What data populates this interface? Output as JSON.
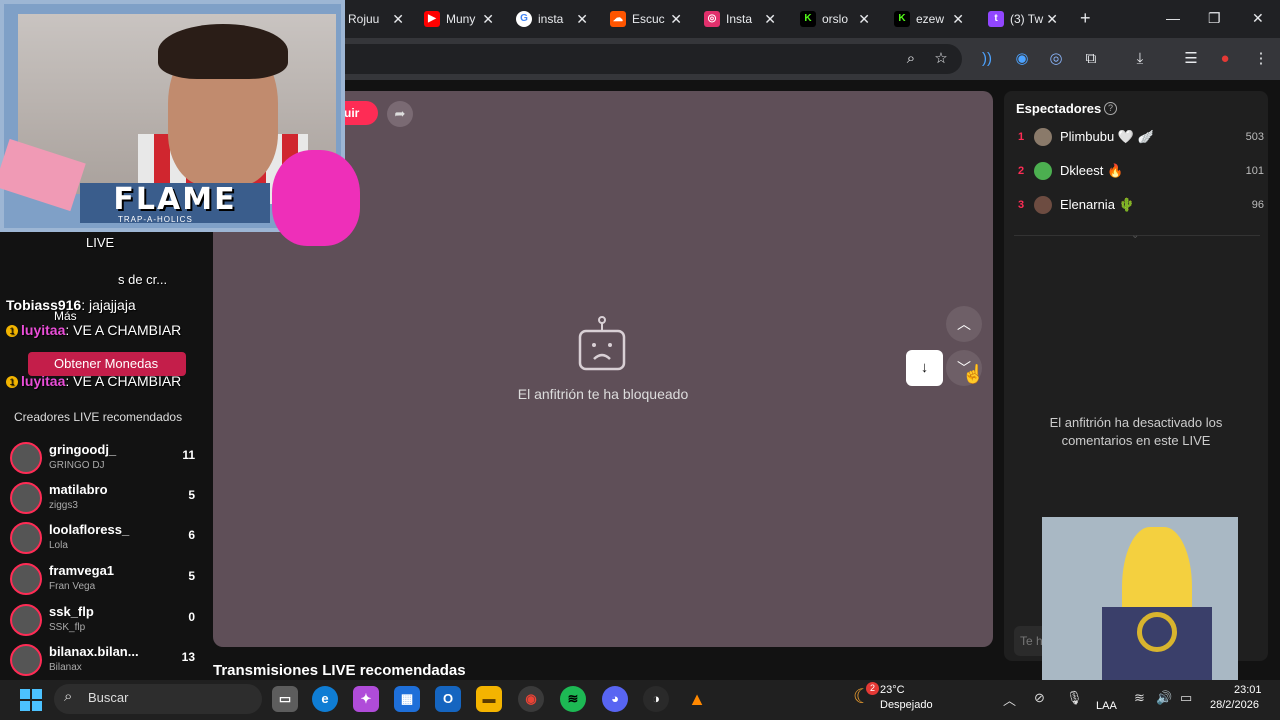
{
  "browser": {
    "tabs": [
      {
        "label": "Rojuu",
        "icon": "generic-tab-icon",
        "icon_color": "#5f6368"
      },
      {
        "label": "Muny",
        "icon": "youtube-icon",
        "icon_color": "#ff0000"
      },
      {
        "label": "insta",
        "icon": "google-icon",
        "icon_color": "#ffffff"
      },
      {
        "label": "Escuc",
        "icon": "soundcloud-icon",
        "icon_color": "#ff5500"
      },
      {
        "label": "Insta",
        "icon": "instagram-icon",
        "icon_color": "#e1306c"
      },
      {
        "label": "orslo",
        "icon": "kick-icon",
        "icon_color": "#53fc18"
      },
      {
        "label": "ezew",
        "icon": "kick-icon",
        "icon_color": "#53fc18"
      },
      {
        "label": "(3) Tw",
        "icon": "twitch-icon",
        "icon_color": "#9146ff"
      }
    ],
    "new_tab": "+",
    "close_symbol": "✕"
  },
  "stream": {
    "follow_label": "uir",
    "blocked_message": "El anfitrión te ha bloqueado",
    "recommended_title": "Transmisiones LIVE recomendadas"
  },
  "viewers": {
    "title": "Espectadores",
    "list": [
      {
        "rank": "1",
        "name": "Plimbubu 🤍 🪽",
        "score": "503",
        "avatar_color": "#8a7a6a"
      },
      {
        "rank": "2",
        "name": "Dkleest 🔥",
        "score": "101",
        "avatar_color": "#4caf50"
      },
      {
        "rank": "3",
        "name": "Elenarnia 🌵",
        "score": "96",
        "avatar_color": "#6d4c41"
      }
    ],
    "comments_disabled": "El anfitrión ha desactivado los comentarios en este LIVE",
    "comment_placeholder": "Te h"
  },
  "overlay": {
    "banner": "FLAME",
    "banner_sub": "TRAP-A-HOLICS",
    "chat": [
      {
        "prefix": "",
        "user": "Tobiass916",
        "text": ": jajajjaja"
      },
      {
        "prefix": "1 ",
        "user": "luyitaa",
        "text": ": VE A CHAMBIAR"
      },
      {
        "prefix": "1 ",
        "user": "luyitaa",
        "text": ": VE A CHAMBIAR"
      }
    ],
    "nav_fragments": [
      "LIVE",
      "s de cr...",
      "Más"
    ],
    "obtain_coins": "Obtener Monedas",
    "recommended_creators_label": "Creadores LIVE recomendados"
  },
  "creators": [
    {
      "name": "gringoodj_",
      "sub": "GRINGO DJ",
      "count": "11"
    },
    {
      "name": "matilabro",
      "sub": "ziggs3",
      "count": "5"
    },
    {
      "name": "loolafloress_",
      "sub": "Lola",
      "count": "6"
    },
    {
      "name": "framvega1",
      "sub": "Fran Vega",
      "count": "5"
    },
    {
      "name": "ssk_flp",
      "sub": "SSK_flp",
      "count": "0"
    },
    {
      "name": "bilanax.bilan...",
      "sub": "Bilanax",
      "count": "13"
    }
  ],
  "taskbar": {
    "search_label": "Buscar",
    "temperature": "23°C",
    "weather": "Despejado",
    "weather_badge": "2",
    "language": "LAA",
    "time": "23:01",
    "date": "28/2/2026"
  }
}
